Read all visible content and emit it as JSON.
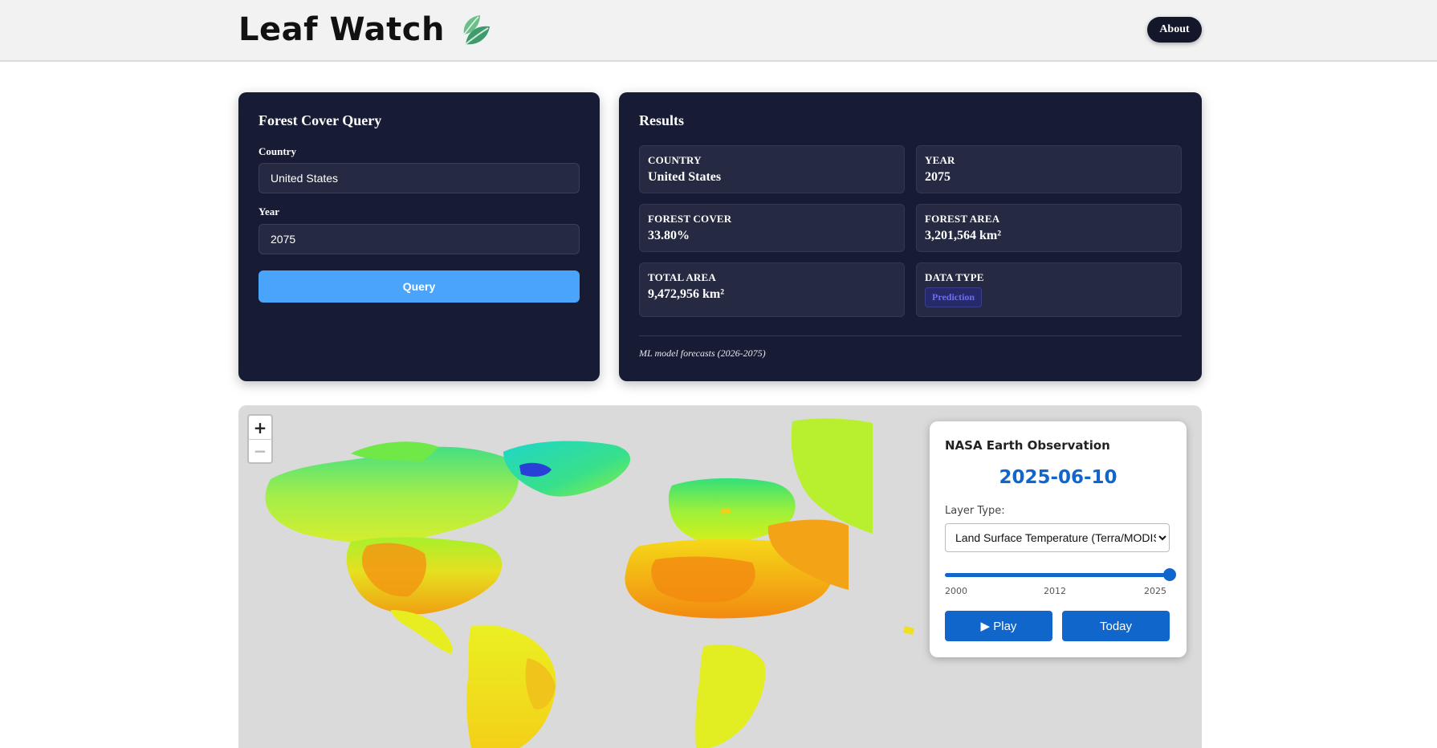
{
  "header": {
    "title": "Leaf Watch",
    "about_label": "About"
  },
  "query": {
    "title": "Forest Cover Query",
    "country_label": "Country",
    "country_value": "United States",
    "year_label": "Year",
    "year_value": "2075",
    "button_label": "Query"
  },
  "results": {
    "title": "Results",
    "items": [
      {
        "label": "COUNTRY",
        "value": "United States"
      },
      {
        "label": "YEAR",
        "value": "2075"
      },
      {
        "label": "FOREST COVER",
        "value": "33.80%"
      },
      {
        "label": "FOREST AREA",
        "value": "3,201,564 km²"
      },
      {
        "label": "TOTAL AREA",
        "value": "9,472,956 km²"
      },
      {
        "label": "DATA TYPE",
        "value": "Prediction"
      }
    ],
    "footnote": "ML model forecasts (2026-2075)"
  },
  "map": {
    "zoom_in": "+",
    "zoom_out": "−"
  },
  "nasa": {
    "title": "NASA Earth Observation",
    "date": "2025-06-10",
    "layer_label": "Layer Type:",
    "layer_selected": "Land Surface Temperature (Terra/MODIS)",
    "slider": {
      "min": 2000,
      "max": 2025,
      "value": 2025
    },
    "ticks": [
      "2000",
      "2012",
      "2025"
    ],
    "play_label": "▶ Play",
    "today_label": "Today"
  },
  "colors": {
    "card_bg": "#171c34",
    "accent": "#4aa5fa",
    "nasa_blue": "#1166cc"
  }
}
